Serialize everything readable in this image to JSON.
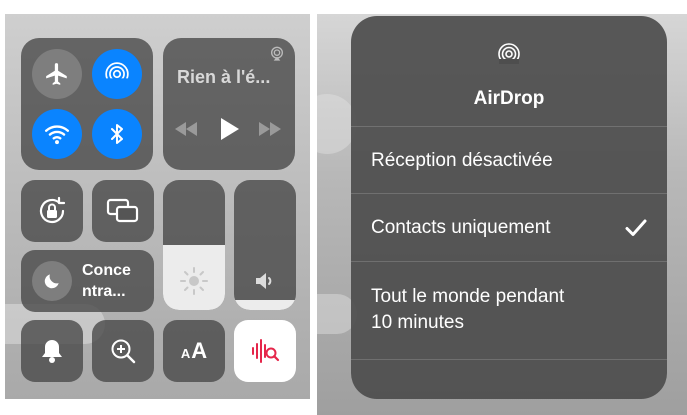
{
  "control_center": {
    "connectivity": {
      "airplane_mode": {
        "icon": "airplane-icon",
        "state": "off"
      },
      "airdrop": {
        "icon": "airdrop-icon",
        "state": "on"
      },
      "wifi": {
        "icon": "wifi-icon",
        "state": "on"
      },
      "bluetooth": {
        "icon": "bluetooth-icon",
        "state": "on"
      }
    },
    "now_playing": {
      "title": "Rien à l'é...",
      "airplay_icon": "airplay-icon",
      "controls": [
        "rewind-icon",
        "play-icon",
        "fast-forward-icon"
      ]
    },
    "orientation_lock": {
      "icon": "orientation-lock-icon"
    },
    "screen_mirroring": {
      "icon": "screen-mirroring-icon"
    },
    "focus": {
      "label_line1": "Conce",
      "label_line2": "ntra...",
      "icon": "moon-icon"
    },
    "brightness": {
      "icon": "sun-icon",
      "level": 0.5
    },
    "volume": {
      "icon": "speaker-icon",
      "level": 0.08
    },
    "bottom_row": [
      "bell-icon",
      "magnifier-icon",
      "text-size-icon",
      "sound-recognition-icon"
    ],
    "text_size": {
      "small": "A",
      "large": "A"
    }
  },
  "airdrop_menu": {
    "icon": "airdrop-icon",
    "title": "AirDrop",
    "options": [
      {
        "label": "Réception désactivée",
        "selected": false
      },
      {
        "label": "Contacts uniquement",
        "selected": true
      },
      {
        "label_line1": "Tout le monde pendant",
        "label_line2": "10 minutes",
        "selected": false
      }
    ]
  },
  "colors": {
    "accent_blue": "#0a84ff",
    "sound_recognition_red": "#e5264a",
    "module_bg": "#464646"
  }
}
